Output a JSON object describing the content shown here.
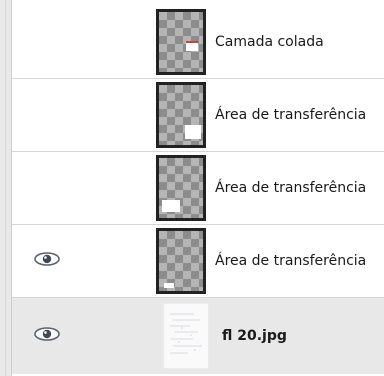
{
  "layers": [
    {
      "name": "Camada colada",
      "visible": false
    },
    {
      "name": "Área de transferência",
      "visible": false
    },
    {
      "name": "Área de transferência",
      "visible": false
    },
    {
      "name": "Área de transferência",
      "visible": true
    },
    {
      "name": "fl 20.jpg",
      "visible": true,
      "selected": true
    }
  ]
}
